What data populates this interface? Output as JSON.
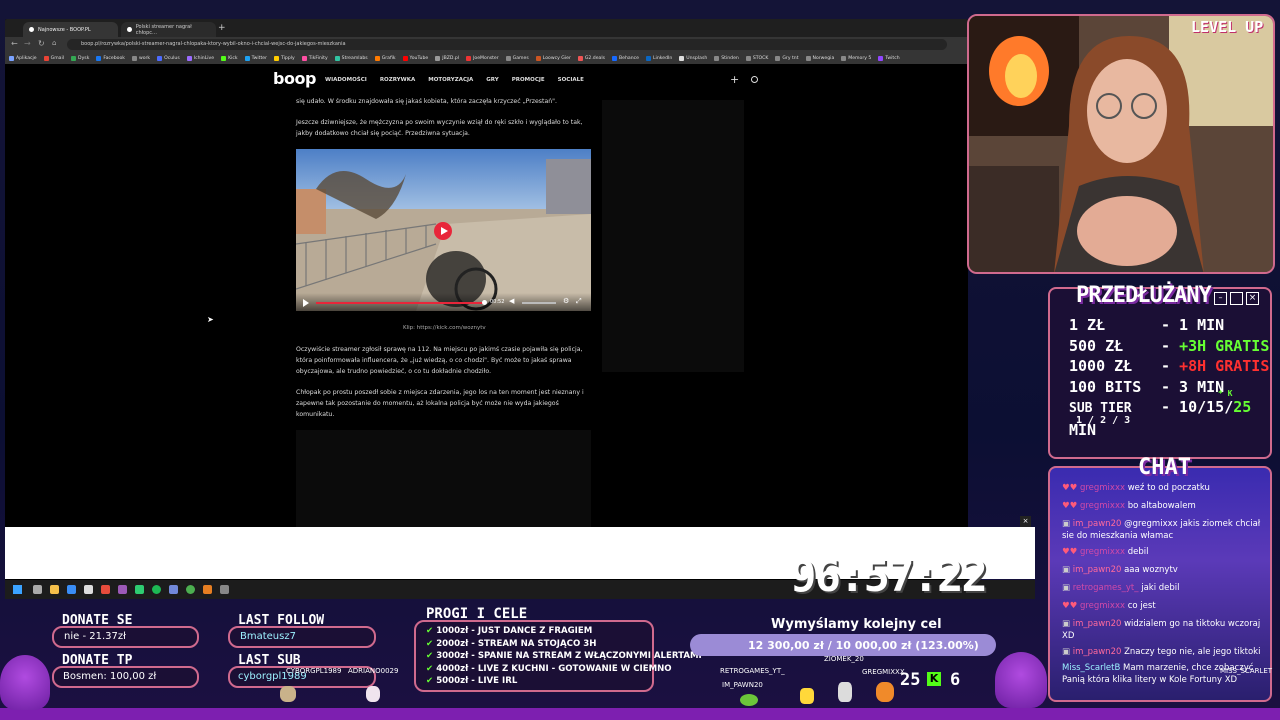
{
  "browser": {
    "tabs": [
      {
        "label": "Najnowsze - BOOP.PL"
      },
      {
        "label": "Polski streamer nagrał chłopc…"
      }
    ],
    "url": "boop.pl/rozrywka/polski-streamer-nagral-chlopaka-ktory-wybil-okno-i-chcial-wejsc-do-jakiegos-mieszkania",
    "bookmarks": [
      "Aplikacje",
      "Gmail",
      "Dysk",
      "Facebook",
      "work",
      "Oculus",
      "IchinLive",
      "Kick",
      "Twitter",
      "Tipply",
      "TikFinity",
      "Streamlabs",
      "Grafik",
      "YouTube",
      "JBZD.pl",
      "JoeMonster",
      "Games",
      "Loowcy Gier",
      "G2.deals",
      "Behance",
      "LinkedIn",
      "Unsplash",
      "Stinden",
      "STOCK",
      "Gry tnt",
      "Norwegia",
      "Memory 5",
      "Twitch"
    ]
  },
  "site": {
    "logo": "boop",
    "nav": [
      "WIADOMOŚCI",
      "ROZRYWKA",
      "MOTORYZACJA",
      "GRY",
      "PROMOCJE",
      "SOCIALE"
    ],
    "para1": "się udało. W środku znajdowała się jakaś kobieta, która zaczęła krzyczeć „Przestań\".",
    "para2": "Jeszcze dziwniejsze, że mężczyzna po swoim wyczynie wziął do ręki szkło i wyglądało to tak, jakby dodatkowo chciał się pociąć. Przedziwna sytuacja.",
    "video_time": "00:52",
    "caption": "Klip: https://kick.com/woznytv",
    "para3": "Oczywiście streamer zgłosił sprawę na 112. Na miejscu po jakimś czasie pojawiła się policja, która poinformowała influencera, że „już wiedzą, o co chodzi\". Być może to jakaś sprawa obyczajowa, ale trudno powiedzieć, o co tu dokładnie chodziło.",
    "para4": "Chłopak po prostu poszedł sobie z miejsca zdarzenia, jego los na ten moment jest nieznany i zapewne tak pozostanie do momentu, aż lokalna policja być może nie wyda jakiegoś komunikatu."
  },
  "overlay": {
    "level_up": "LEVEL UP",
    "timer": "96:57:22",
    "extended": {
      "title": "PRZEDŁUŻANY",
      "rows": [
        {
          "left": "1 ZŁ",
          "right": "- 1 MIN",
          "extra": ""
        },
        {
          "left": "500 ZŁ",
          "right": "- ",
          "extra": "+3H GRATIS"
        },
        {
          "left": "1000 ZŁ",
          "right": "- ",
          "extra": "+8H GRATIS"
        },
        {
          "left": "100 BITS",
          "right": "- 3 MIN",
          "extra": ""
        },
        {
          "left": "SUB TIER",
          "right": "- 10/15/",
          "extra": "25",
          "tail": " MIN"
        }
      ],
      "tier_sub": "1 / 2 / 3",
      "k": "* K"
    },
    "chat": {
      "title": "CHAT",
      "messages": [
        {
          "user": "gregmixxx",
          "text": "weź to od poczatku"
        },
        {
          "user": "gregmixxx",
          "text": "bo altabowalem"
        },
        {
          "user": "im_pawn20",
          "text": "@gregmixxx jakis ziomek chciał sie do mieszkania włamac"
        },
        {
          "user": "gregmixxx",
          "text": "debil"
        },
        {
          "user": "im_pawn20",
          "text": "aaa woznytv"
        },
        {
          "user": "retrogames_yt_",
          "text": "jaki debil"
        },
        {
          "user": "gregmixxx",
          "text": "co jest"
        },
        {
          "user": "im_pawn20",
          "text": "widzialem go na tiktoku wczoraj XD"
        },
        {
          "user": "im_pawn20",
          "text": "Znaczy tego nie, ale jego tiktoki"
        },
        {
          "user": "Miss_ScarletB",
          "text": "Mam marzenie, chce zobaczyć Panią która klika litery w Kole Fortuny XD"
        }
      ]
    },
    "donate_se": {
      "title": "DONATE SE",
      "value": "nie - 21.37zł"
    },
    "donate_tp": {
      "title": "DONATE TP",
      "value": "Bosmen: 100,00 zł"
    },
    "last_follow": {
      "title": "LAST FOLLOW",
      "value": "Bmateusz7"
    },
    "last_sub": {
      "title": "LAST SUB",
      "value": "cyborgpl1989"
    },
    "thresholds": {
      "title": "PROGI I CELE",
      "items": [
        "1000zł - JUST DANCE Z FRAGIEM",
        "2000zł - STREAM NA STOJĄCO 3H",
        "3000zł - SPANIE NA STREAM Z WŁĄCZONYMI ALERTAMI",
        "4000zł - LIVE Z KUCHNI - GOTOWANIE W CIEMNO",
        "5000zł - LIVE IRL"
      ]
    },
    "goal": {
      "title": "Wymyślamy kolejny cel",
      "progress_text": "12 300,00 zł / 10 000,00 zł (123.00%)",
      "progress": 1.0
    },
    "counters": {
      "a": "25",
      "b": "6"
    },
    "names": [
      "RETROGAMES_YT_",
      "IM_PAWN20",
      "ZIOMEK_20",
      "GREGMIXXX",
      "CYBORGPL1989",
      "ADRIANO0029",
      "MISS_SCARLET"
    ]
  }
}
